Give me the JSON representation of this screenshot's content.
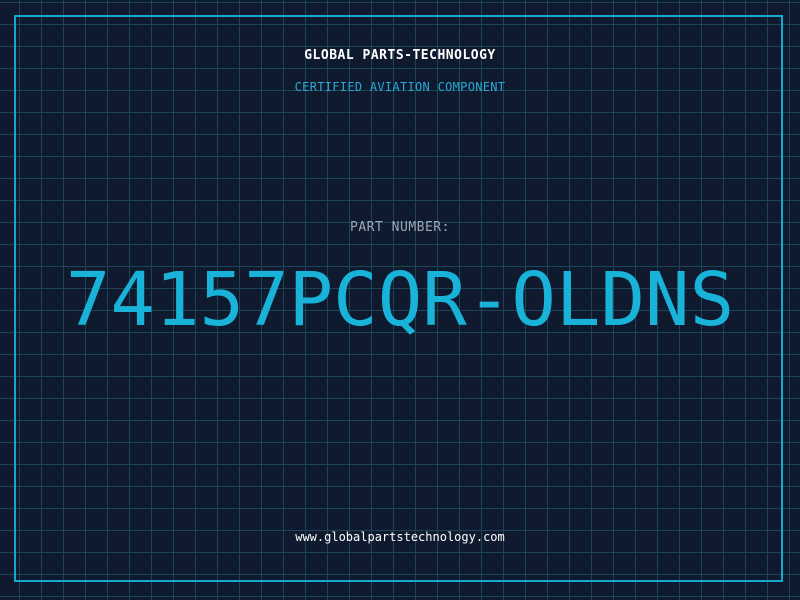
{
  "company": "GLOBAL PARTS-TECHNOLOGY",
  "certification": "CERTIFIED AVIATION COMPONENT",
  "part_number_label": "PART NUMBER:",
  "part_number": "74157PCQR-OLDNS",
  "website": "www.globalpartstechnology.com",
  "colors": {
    "background": "#101a2e",
    "grid": "#1f4a5e",
    "accent": "#14a9cf",
    "text": "#ffffff"
  }
}
